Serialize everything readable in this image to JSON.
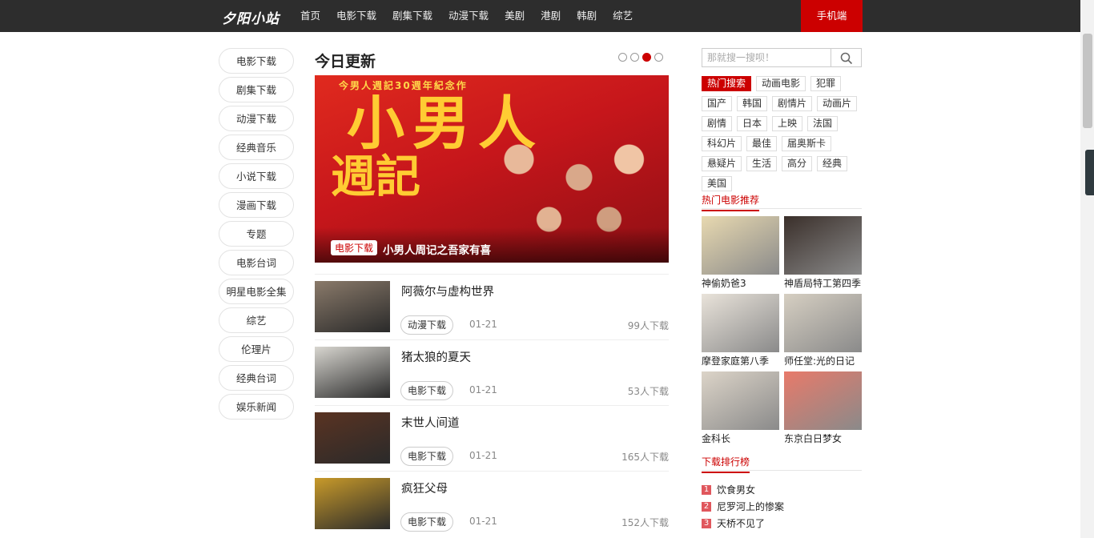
{
  "site": {
    "logo": "夕阳小站",
    "mobile_label": "手机端"
  },
  "nav": [
    "首页",
    "电影下载",
    "剧集下载",
    "动漫下载",
    "美剧",
    "港剧",
    "韩剧",
    "综艺"
  ],
  "sidebar": [
    "电影下载",
    "剧集下载",
    "动漫下载",
    "经典音乐",
    "小说下载",
    "漫画下载",
    "专题",
    "电影台词",
    "明星电影全集",
    "综艺",
    "伦理片",
    "经典台词",
    "娱乐新闻"
  ],
  "today": {
    "title": "今日更新",
    "slider": {
      "count": 4,
      "active_index": 2
    },
    "banner": {
      "tag": "电影下载",
      "caption": "小男人周记之吾家有喜",
      "poster_top": "今男人週記30週年紀念作",
      "poster_big1": "小男人",
      "poster_big2": "週記"
    },
    "items": [
      {
        "title": "阿薇尔与虚构世界",
        "tag": "动漫下载",
        "date": "01-21",
        "downloads": "99人下载",
        "thumb_color": "#8a7a6a"
      },
      {
        "title": "猪太狼的夏天",
        "tag": "电影下载",
        "date": "01-21",
        "downloads": "53人下载",
        "thumb_color": "#d8d6d0"
      },
      {
        "title": "末世人间道",
        "tag": "电影下载",
        "date": "01-21",
        "downloads": "165人下载",
        "thumb_color": "#5a3322"
      },
      {
        "title": "疯狂父母",
        "tag": "电影下载",
        "date": "01-21",
        "downloads": "152人下载",
        "thumb_color": "#c89a2a"
      }
    ]
  },
  "search": {
    "placeholder": "那就搜一搜呗！"
  },
  "hot_tags": [
    "热门搜索",
    "动画电影",
    "犯罪",
    "国产",
    "韩国",
    "剧情片",
    "动画片",
    "剧情",
    "日本",
    "上映",
    "法国",
    "科幻片",
    "最佳",
    "届奥斯卡",
    "悬疑片",
    "生活",
    "高分",
    "经典",
    "美国"
  ],
  "recommend": {
    "title": "热门电影推荐",
    "items": [
      {
        "name": "神偷奶爸3",
        "color": "#e8d9b0"
      },
      {
        "name": "神盾局特工第四季",
        "color": "#3a2f2a"
      },
      {
        "name": "摩登家庭第八季",
        "color": "#e9e3da"
      },
      {
        "name": "师任堂:光的日记",
        "color": "#d6cfc2"
      },
      {
        "name": "金科长",
        "color": "#dcd4c8"
      },
      {
        "name": "东京白日梦女",
        "color": "#e87a6a"
      }
    ]
  },
  "ranking": {
    "title": "下载排行榜",
    "items": [
      {
        "num": "1",
        "name": "饮食男女"
      },
      {
        "num": "2",
        "name": "尼罗河上的惨案"
      },
      {
        "num": "3",
        "name": "天桥不见了"
      }
    ]
  }
}
